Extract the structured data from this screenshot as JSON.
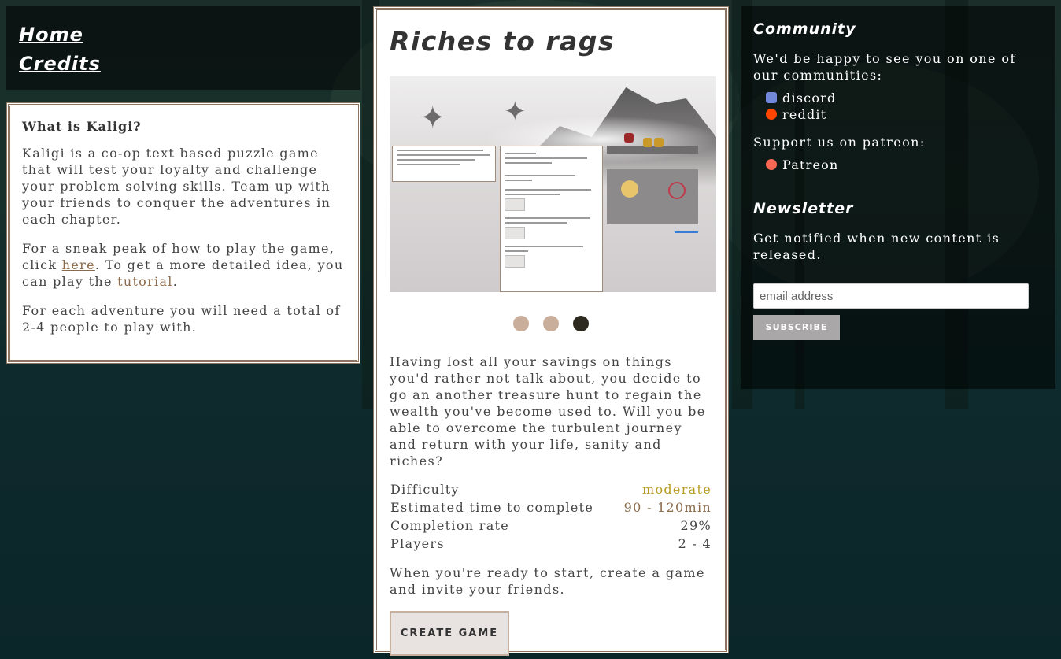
{
  "nav": {
    "items": [
      {
        "label": "Home"
      },
      {
        "label": "Credits"
      }
    ]
  },
  "about": {
    "heading": "What is Kaligi?",
    "para1": "Kaligi is a co-op text based puzzle game that will test your loyalty and challenge your problem solving skills. Team up with your friends to conquer the adventures in each chapter.",
    "para2_before": "For a sneak peak of how to play the game, click ",
    "para2_link1": "here",
    "para2_middle": ". To get a more detailed idea, you can play the ",
    "para2_link2": "tutorial",
    "para2_after": ".",
    "para3": "For each adventure you will need a total of 2-4 people to play with."
  },
  "adventure": {
    "title": "Riches to rags",
    "carousel": {
      "slide_count": 3,
      "active_index": 2
    },
    "description": "Having lost all your savings on things you'd rather not talk about, you decide to go an another treasure hunt to regain the wealth you've become used to. Will you be able to overcome the turbulent journey and return with your life, sanity and riches?",
    "stats": [
      {
        "label": "Difficulty",
        "value": "moderate",
        "color": "#b89a1e"
      },
      {
        "label": "Estimated time to complete",
        "value": "90 - 120min",
        "color": "#8a6a4a"
      },
      {
        "label": "Completion rate",
        "value": "29%"
      },
      {
        "label": "Players",
        "value": "2 - 4"
      }
    ],
    "ready_text": "When you're ready to start, create a game and invite your friends.",
    "create_button": "CREATE GAME"
  },
  "community": {
    "heading": "Community",
    "intro": "We'd be happy to see you on one of our communities:",
    "links": [
      {
        "label": "discord",
        "icon": "discord-icon"
      },
      {
        "label": "reddit",
        "icon": "reddit-icon"
      }
    ],
    "patreon_intro": "Support us on patreon:",
    "patreon": {
      "label": "Patreon",
      "icon": "patreon-icon"
    }
  },
  "newsletter": {
    "heading": "Newsletter",
    "text": "Get notified when new content is released.",
    "email_placeholder": "email address",
    "subscribe_label": "SUBSCRIBE"
  },
  "colors": {
    "frame_border": "#8b735f",
    "link": "#8a6a4a",
    "dot_inactive": "#c9ae9b",
    "dot_active": "#2f2a1f"
  }
}
